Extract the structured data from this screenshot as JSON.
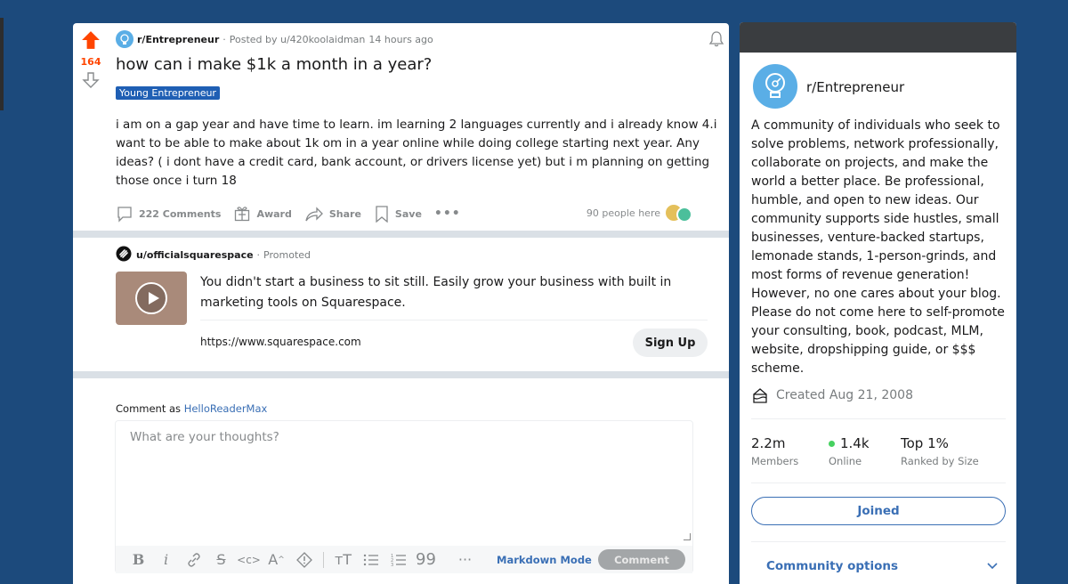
{
  "post": {
    "vote_count": "164",
    "subreddit": "r/Entrepreneur",
    "posted_by": "Posted by u/420koolaidman",
    "time_ago": "14 hours ago",
    "title": "how can i make $1k a month in a year?",
    "flair": "Young Entrepreneur",
    "body": "i am on a gap year and have time to learn. im learning 2 languages currently and i already know 4.i want to be able to make about 1k om in a year online while doing college starting next year. Any ideas? ( i dont have a credit card, bank account, or drivers license yet) but i m planning on getting those once i turn 18",
    "actions": {
      "comments": "222 Comments",
      "award": "Award",
      "share": "Share",
      "save": "Save",
      "more": "•••"
    },
    "people_here": "90 people here"
  },
  "promoted": {
    "user": "u/officialsquarespace",
    "label": "Promoted",
    "text": "You didn't start a business to sit still. Easily grow your business with built in marketing tools on Squarespace.",
    "url": "https://www.squarespace.com",
    "cta": "Sign Up"
  },
  "comment": {
    "comment_as_prefix": "Comment as",
    "username": "HelloReaderMax",
    "placeholder": "What are your thoughts?",
    "toolbar": {
      "markdown_mode": "Markdown Mode",
      "submit": "Comment"
    }
  },
  "sidebar": {
    "community_name": "r/Entrepreneur",
    "description": "A community of individuals who seek to solve problems, network professionally, collaborate on projects, and make the world a better place. Be professional, humble, and open to new ideas. Our community supports side hustles, small businesses, venture-backed startups, lemonade stands, 1-person-grinds, and most forms of revenue generation! However, no one cares about your blog. Please do not come here to self-promote your consulting, book, podcast, MLM, website, dropshipping guide, or $$$ scheme.",
    "created": "Created Aug 21, 2008",
    "stats": [
      {
        "value": "2.2m",
        "label": "Members"
      },
      {
        "value": "1.4k",
        "label": "Online"
      },
      {
        "value": "Top 1%",
        "label": "Ranked by Size"
      }
    ],
    "joined_label": "Joined",
    "community_options": "Community options"
  },
  "colors": {
    "background": "#1c4a7c",
    "upvote": "#ff4500",
    "flair": "#1f5fb4",
    "link": "#3a6fb5",
    "online": "#46d160"
  }
}
